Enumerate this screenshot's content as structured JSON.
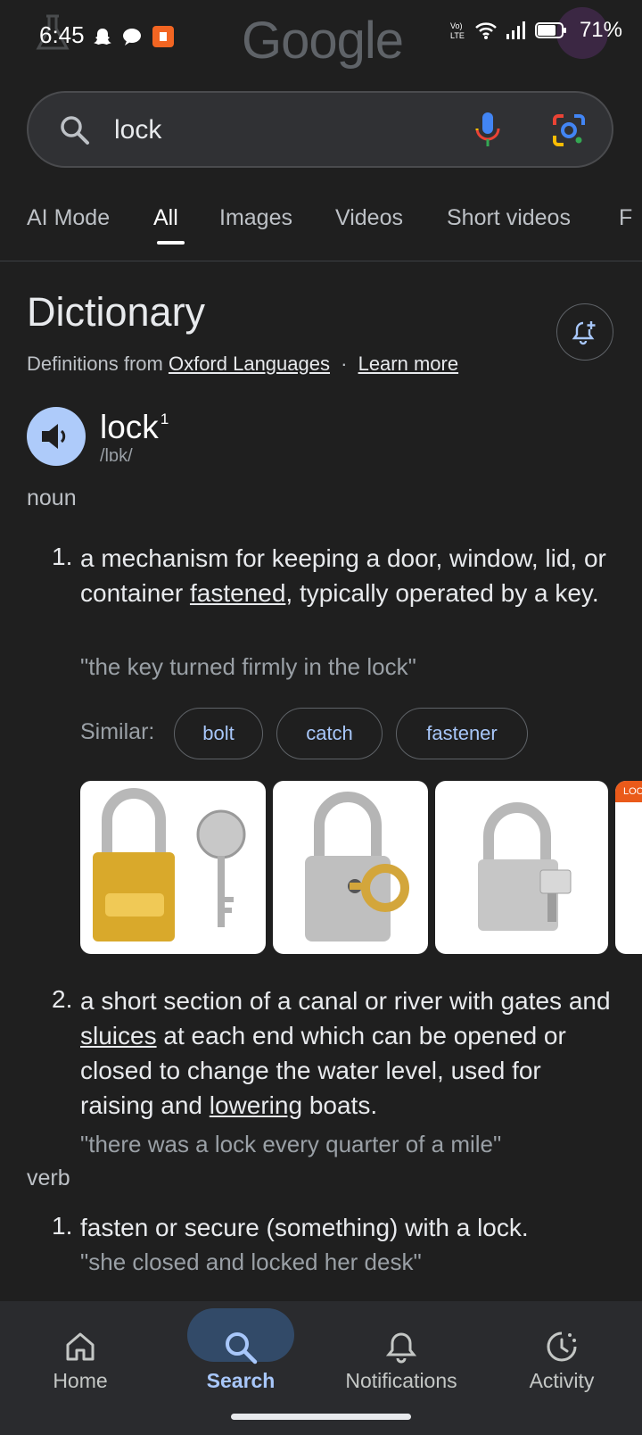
{
  "status_bar": {
    "time": "6:45",
    "battery": "71%",
    "network": "Vo) LTE"
  },
  "header": {
    "logo": "Google"
  },
  "search": {
    "query": "lock"
  },
  "tabs": [
    {
      "label": "AI Mode"
    },
    {
      "label": "All",
      "active": true
    },
    {
      "label": "Images"
    },
    {
      "label": "Videos"
    },
    {
      "label": "Short videos"
    },
    {
      "label": "F"
    }
  ],
  "dictionary": {
    "title": "Dictionary",
    "source_prefix": "Definitions from",
    "source_link": "Oxford Languages",
    "separator": "·",
    "learn_more": "Learn more",
    "word": "lock",
    "superscript": "1",
    "phonetic": "/lɒk/",
    "senses": [
      {
        "pos": "noun",
        "definitions": [
          {
            "number": "1.",
            "parts": [
              "a mechanism for keeping a door, window, lid, or container ",
              "fastened",
              ", typically operated by a key."
            ],
            "example": "\"the key turned firmly in the lock\""
          },
          {
            "number": "2.",
            "parts": [
              "a short section of a canal or river with gates and ",
              "sluices",
              " at each end which can be opened or closed to change the water level, used for raising and ",
              "lowering",
              " boats."
            ],
            "example": "\"there was a lock every quarter of a mile\""
          }
        ]
      },
      {
        "pos": "verb",
        "definitions": [
          {
            "number": "1.",
            "parts": [
              "fasten or secure (something) with a lock."
            ],
            "example": "\"she closed and locked her desk\""
          }
        ]
      }
    ],
    "similar_label": "Similar:",
    "similar": [
      "bolt",
      "catch",
      "fastener"
    ],
    "images": [
      {
        "name": "padlock-and-key-gold"
      },
      {
        "name": "padlock-with-key-silver"
      },
      {
        "name": "padlock-silver-with-key"
      },
      {
        "name": "lock-partial",
        "badge": "LOC"
      }
    ]
  },
  "bottom_nav": [
    {
      "label": "Home",
      "icon": "home-icon"
    },
    {
      "label": "Search",
      "icon": "search-icon",
      "active": true
    },
    {
      "label": "Notifications",
      "icon": "bell-icon"
    },
    {
      "label": "Activity",
      "icon": "activity-icon"
    }
  ],
  "colors": {
    "background": "#1f1f1f",
    "accent_blue": "#a8c7fa",
    "speaker_button": "#aecbfa",
    "search_pill": "#324a68"
  }
}
